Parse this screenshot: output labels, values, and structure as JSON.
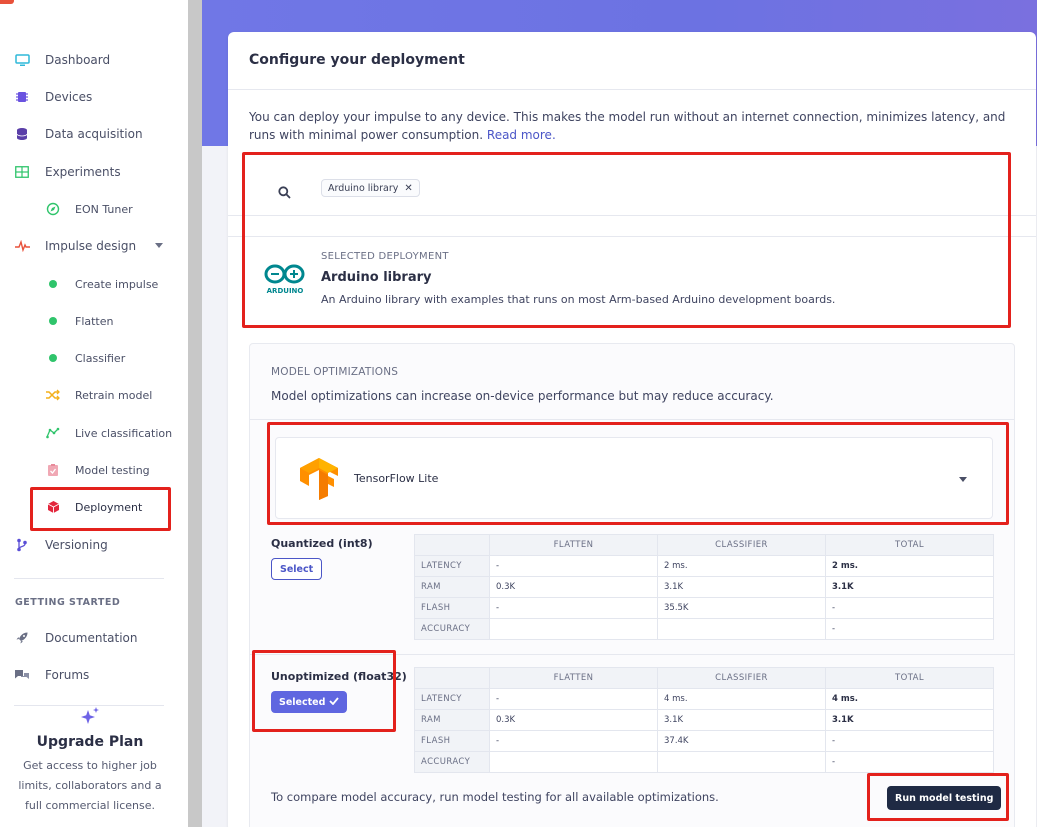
{
  "sidebar": {
    "items": [
      {
        "label": "Dashboard",
        "icon": "monitor-icon",
        "color": "#2fb8d9"
      },
      {
        "label": "Devices",
        "icon": "chip-icon",
        "color": "#6a53e0"
      },
      {
        "label": "Data acquisition",
        "icon": "database-icon",
        "color": "#5a3ea8"
      },
      {
        "label": "Experiments",
        "icon": "table-icon",
        "color": "#2fc46b"
      },
      {
        "label": "EON Tuner",
        "icon": "compass-icon",
        "color": "#2fc46b"
      },
      {
        "label": "Impulse design",
        "icon": "pulse-icon",
        "color": "#e8513a"
      },
      {
        "label": "Create impulse",
        "icon": "dot-icon",
        "color": "#2fc46b"
      },
      {
        "label": "Flatten",
        "icon": "dot-icon",
        "color": "#2fc46b"
      },
      {
        "label": "Classifier",
        "icon": "dot-icon",
        "color": "#2fc46b"
      },
      {
        "label": "Retrain model",
        "icon": "shuffle-icon",
        "color": "#f3b01b"
      },
      {
        "label": "Live classification",
        "icon": "graph-icon",
        "color": "#2fc46b"
      },
      {
        "label": "Model testing",
        "icon": "clipboard-check-icon",
        "color": "#e88a9a"
      },
      {
        "label": "Deployment",
        "icon": "cube-icon",
        "color": "#e3263c"
      },
      {
        "label": "Versioning",
        "icon": "branch-icon",
        "color": "#5a4fd6"
      }
    ],
    "getting_started_title": "GETTING STARTED",
    "getting_started": [
      {
        "label": "Documentation",
        "icon": "rocket-icon"
      },
      {
        "label": "Forums",
        "icon": "chat-icon"
      }
    ],
    "upgrade": {
      "title": "Upgrade Plan",
      "description": "Get access to higher job limits, collaborators and a full commercial license."
    }
  },
  "main": {
    "title": "Configure your deployment",
    "intro_text": "You can deploy your impulse to any device. This makes the model run without an internet connection, minimizes latency, and runs with minimal power consumption.",
    "intro_link": "Read more.",
    "search_tag": "Arduino library",
    "selected_header": "SELECTED DEPLOYMENT",
    "selected_name": "Arduino library",
    "selected_desc": "An Arduino library with examples that runs on most Arm-based Arduino development boards.",
    "arduino_logo_text": "ARDUINO",
    "optimizations": {
      "header": "MODEL OPTIMIZATIONS",
      "description": "Model optimizations can increase on-device performance but may reduce accuracy.",
      "engine": "TensorFlow Lite",
      "columns": [
        "",
        "FLATTEN",
        "CLASSIFIER",
        "TOTAL"
      ],
      "variants": [
        {
          "name": "Quantized (int8)",
          "button": "Select",
          "selected": false,
          "rows": [
            [
              "LATENCY",
              "-",
              "2 ms.",
              "2 ms."
            ],
            [
              "RAM",
              "0.3K",
              "3.1K",
              "3.1K"
            ],
            [
              "FLASH",
              "-",
              "35.5K",
              "-"
            ],
            [
              "ACCURACY",
              "",
              "",
              "-"
            ]
          ]
        },
        {
          "name": "Unoptimized (float32)",
          "button": "Selected",
          "selected": true,
          "rows": [
            [
              "LATENCY",
              "-",
              "4 ms.",
              "4 ms."
            ],
            [
              "RAM",
              "0.3K",
              "3.1K",
              "3.1K"
            ],
            [
              "FLASH",
              "-",
              "37.4K",
              "-"
            ],
            [
              "ACCURACY",
              "",
              "",
              "-"
            ]
          ]
        }
      ],
      "compare_text": "To compare model accuracy, run model testing for all available optimizations.",
      "run_button": "Run model testing"
    }
  },
  "colors": {
    "accent": "#5f66e0",
    "hero": "#6e74e4",
    "annotation": "#e3211c",
    "dark_button": "#1f2a44"
  }
}
